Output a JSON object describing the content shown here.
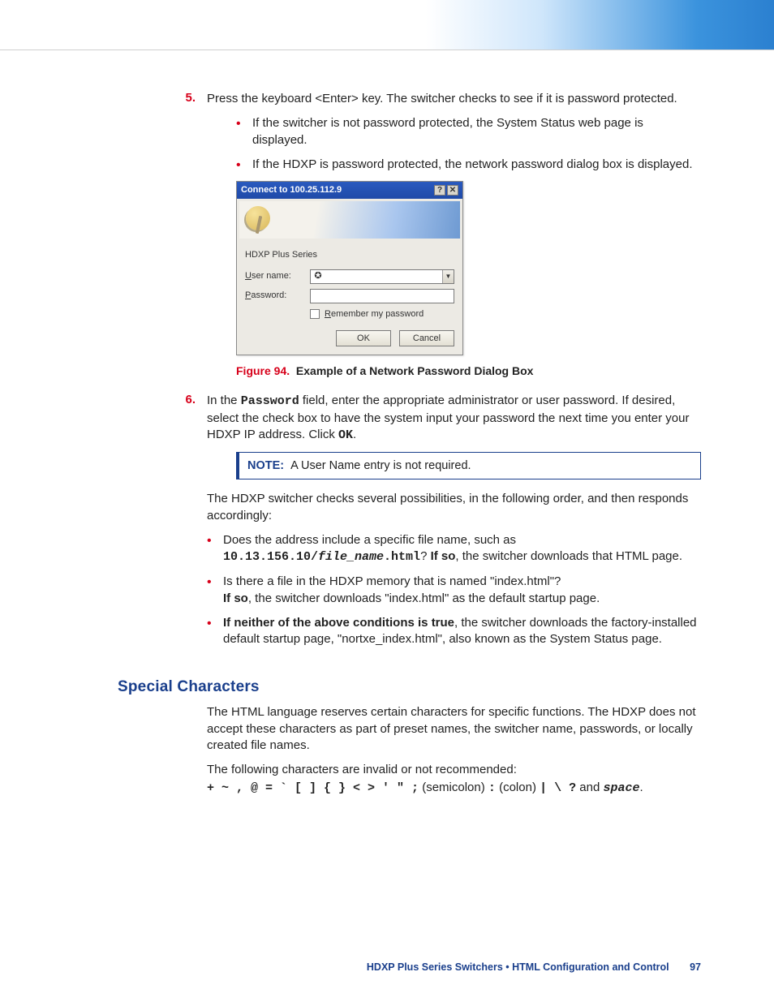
{
  "step5": {
    "num": "5.",
    "text": "Press the keyboard <Enter> key. The switcher checks to see if it is password protected.",
    "b1": "If the switcher is not password protected, the System Status web page is displayed.",
    "b2": "If the HDXP is password protected, the network password dialog box is displayed."
  },
  "dialog": {
    "title": "Connect to 100.25.112.9",
    "btn_help": "?",
    "btn_close": "✕",
    "series": "HDXP Plus Series",
    "user_u": "U",
    "user_rest": "ser name:",
    "pass_u": "P",
    "pass_rest": "assword:",
    "remember_u": "R",
    "remember_rest": "emember my password",
    "ok": "OK",
    "cancel": "Cancel",
    "dd": "▼",
    "glyph": "✪"
  },
  "figure": {
    "num": "Figure 94.",
    "title": "Example of a Network Password Dialog Box"
  },
  "step6": {
    "num": "6.",
    "t1": "In the ",
    "pw": "Password",
    "t2": " field, enter the appropriate administrator or user password. If desired, select the check box to have the system input your password the next time you enter your HDXP IP address. Click ",
    "ok": "OK",
    "t3": "."
  },
  "note": {
    "label": "NOTE:",
    "text": "A User Name entry is not required."
  },
  "para1": "The HDXP switcher checks several possibilities, in the following order, and then responds accordingly:",
  "checks": {
    "c1a": "Does the address include a specific file name, such as ",
    "c1ip": "10.13.156.10/",
    "c1file": "file_name",
    "c1ext": ".html",
    "c1q": "? ",
    "ifso": "If so",
    "c1b": ", the switcher downloads that HTML page.",
    "c2a": "Is there a file in the HDXP memory that is named \"index.html\"?",
    "c2b": ", the switcher downloads \"index.html\" as the default startup page.",
    "c3a": "If neither of the above conditions is true",
    "c3b": ", the switcher downloads the factory-installed default startup page, \"nortxe_index.html\", also known as the System Status page."
  },
  "special": {
    "heading": "Special Characters",
    "p1": "The HTML language reserves certain characters for specific functions. The HDXP does not accept these characters as part of preset names, the switcher name, passwords, or locally created file names.",
    "p2": "The following characters are invalid or not recommended:",
    "chars1": "+ ~ , @ = ` [ ] { } < > ' \" ;",
    "semi": " (semicolon) ",
    "colon_c": ":",
    "colon_t": " (colon) ",
    "chars2": "| \\ ?",
    "and": " and ",
    "space": "space",
    "dot": "."
  },
  "footer": {
    "t": "HDXP Plus Series Switchers • HTML Configuration and Control",
    "pg": "97"
  }
}
